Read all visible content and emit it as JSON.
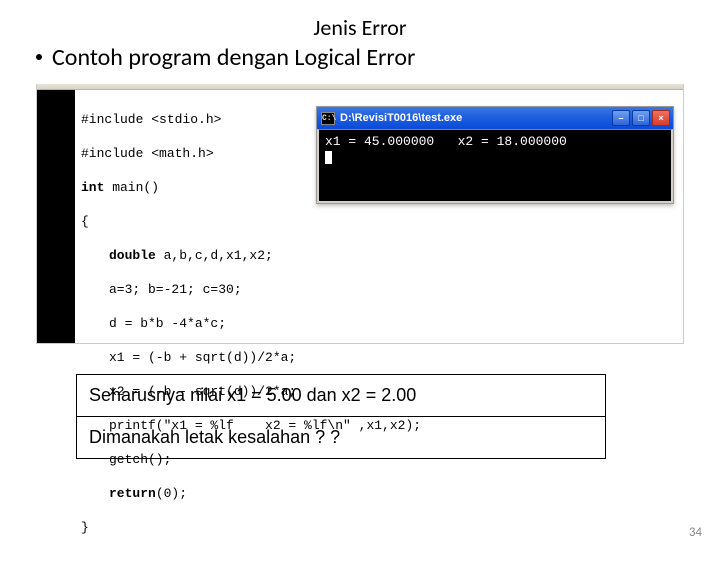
{
  "slide": {
    "title": "Jenis Error",
    "subtitle": "Contoh program dengan Logical Error",
    "page_number": "34"
  },
  "code": {
    "l1a": "#include ",
    "l1b": "<stdio.h>",
    "l2a": "#include ",
    "l2b": "<math.h>",
    "l3a": "int",
    "l3b": " main()",
    "l4": "{",
    "l5a": "double",
    "l5b": " a,b,c,d,x1,x2;",
    "l6": "a=3; b=-21; c=30;",
    "l7": "d = b*b -4*a*c;",
    "l8": "x1 = (-b + sqrt(d))/2*a;",
    "l9": "x2 = (-b - sqrt(d))/2*a;",
    "l10": "printf(\"x1 = %lf    x2 = %lf\\n\" ,x1,x2);",
    "l11": "getch();",
    "l12a": "return",
    "l12b": "(0);",
    "l13": "}"
  },
  "console": {
    "icon_glyph": "C:\\",
    "title": " D:\\RevisiT0016\\test.exe",
    "min_glyph": "–",
    "max_glyph": "□",
    "close_glyph": "×",
    "output": "x1 = 45.000000   x2 = 18.000000"
  },
  "notes": {
    "line1": "Seharusnya nilai x1 = 5.00  dan  x2 = 2.00",
    "line2": "Dimanakah letak kesalahan  ? ?"
  }
}
